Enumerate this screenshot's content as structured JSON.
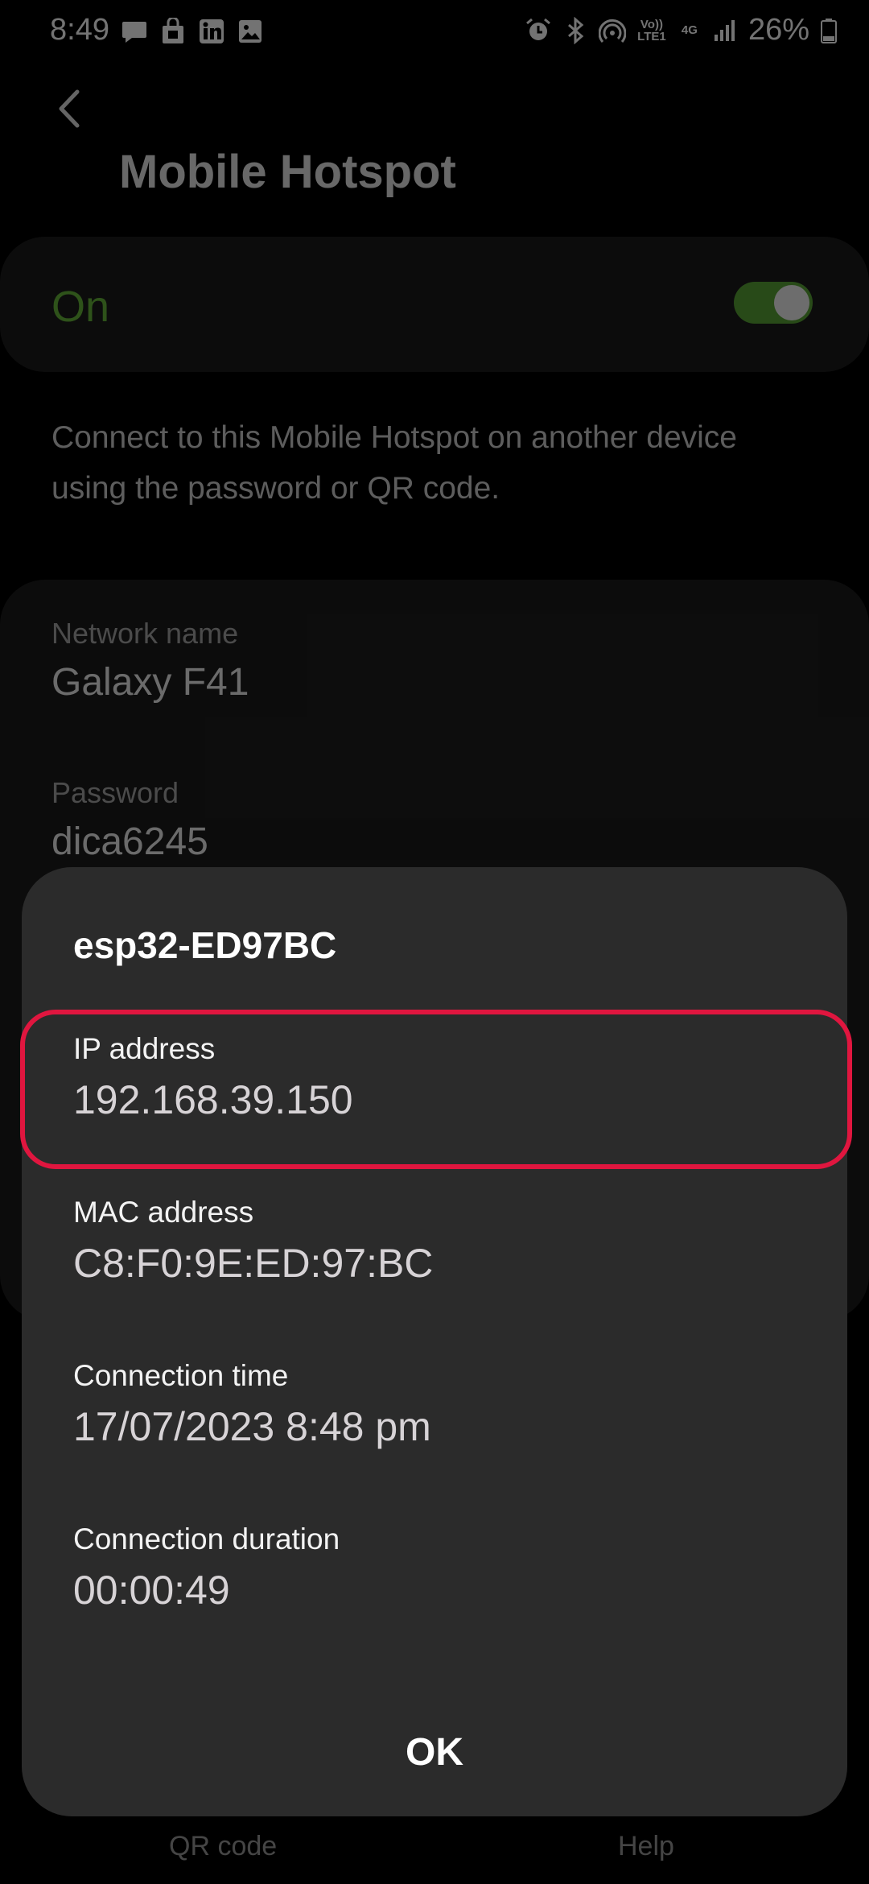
{
  "status_bar": {
    "time": "8:49",
    "battery": "26%",
    "network_volte": "Vo)) LTE1",
    "network_type": "4G",
    "left_icons": [
      "chat-icon",
      "bag-icon",
      "linkedin-icon",
      "gallery-icon"
    ],
    "right_icons": [
      "alarm-icon",
      "bluetooth-icon",
      "hotspot-icon",
      "signal-icon",
      "battery-icon"
    ]
  },
  "header": {
    "title": "Mobile Hotspot"
  },
  "toggle": {
    "label": "On",
    "state": "on",
    "accent": "#66b73a"
  },
  "description": "Connect to this Mobile Hotspot on another device using the password or QR code.",
  "network": {
    "name_label": "Network name",
    "name_value": "Galaxy F41",
    "password_label": "Password",
    "password_value": "dica6245"
  },
  "bottom_nav": {
    "left": "QR code",
    "right": "Help"
  },
  "dialog": {
    "title": "esp32-ED97BC",
    "ip_label": "IP address",
    "ip_value": "192.168.39.150",
    "mac_label": "MAC address",
    "mac_value": "C8:F0:9E:ED:97:BC",
    "conn_time_label": "Connection time",
    "conn_time_value": "17/07/2023 8:48 pm",
    "conn_duration_label": "Connection duration",
    "conn_duration_value": "00:00:49",
    "ok_label": "OK",
    "highlight_color": "#e0163f"
  }
}
